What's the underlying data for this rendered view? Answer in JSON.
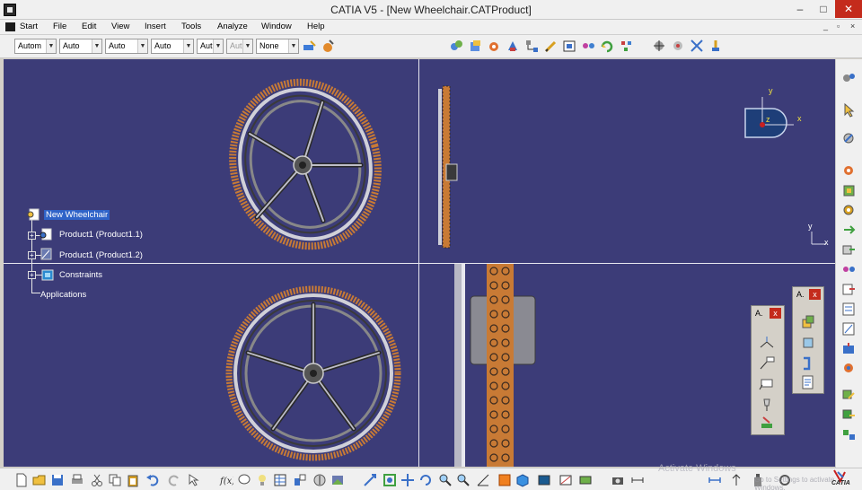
{
  "window": {
    "title": "CATIA V5 - [New Wheelchair.CATProduct]",
    "min_glyph": "–",
    "max_glyph": "□",
    "close_glyph": "✕"
  },
  "menu": {
    "items": [
      {
        "label": "Start"
      },
      {
        "label": "File"
      },
      {
        "label": "Edit"
      },
      {
        "label": "View"
      },
      {
        "label": "Insert"
      },
      {
        "label": "Tools"
      },
      {
        "label": "Analyze"
      },
      {
        "label": "Window"
      },
      {
        "label": "Help"
      }
    ],
    "mdi_min": "_",
    "mdi_restore": "▫",
    "mdi_close": "×"
  },
  "toolbar": {
    "combos": [
      {
        "value": "Autom"
      },
      {
        "value": "Auto"
      },
      {
        "value": "Auto"
      },
      {
        "value": "Auto"
      },
      {
        "value": "Aut"
      },
      {
        "value": "Aut",
        "disabled": true
      },
      {
        "value": "None"
      }
    ]
  },
  "tree": {
    "root": "New Wheelchair",
    "children": [
      {
        "label": "Product1 (Product1.1)"
      },
      {
        "label": "Product1 (Product1.2)"
      },
      {
        "label": "Constraints"
      }
    ],
    "applications": "Applications"
  },
  "compass": {
    "x": "x",
    "y": "y",
    "z": "z"
  },
  "axis_mini": {
    "y": "y",
    "x": "x"
  },
  "float_toolbars": {
    "first_title": "A.",
    "second_title": "A.",
    "close_glyph": "x"
  },
  "watermark": {
    "line1": "Activate Windows",
    "line2": "Go to Settings to activate Windows."
  },
  "logo_text": "CATIA",
  "colors": {
    "viewport_bg": "#3c3c78",
    "tire": "#c87a35",
    "rim": "#c8c8d0",
    "selection": "#2f63c8"
  }
}
